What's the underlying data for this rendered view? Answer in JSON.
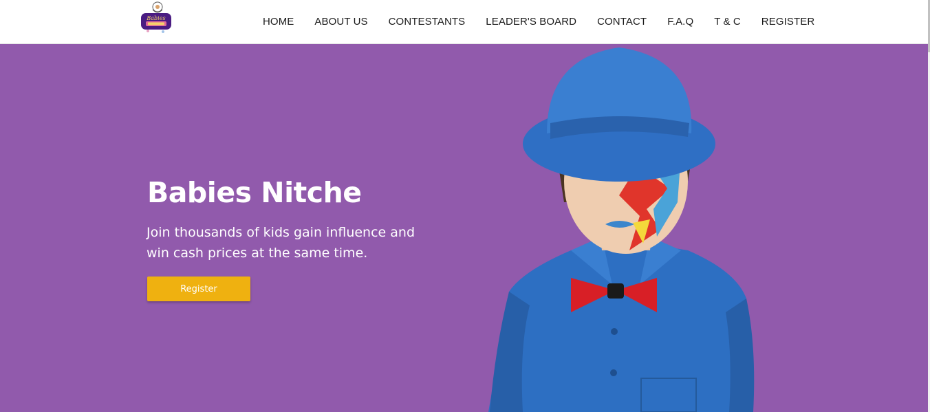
{
  "brand": {
    "logo_icon": "babies-nitche-logo-icon",
    "logo_text": "Babies Nitche"
  },
  "nav": {
    "items": [
      {
        "label": "HOME"
      },
      {
        "label": "ABOUT US"
      },
      {
        "label": "CONTESTANTS"
      },
      {
        "label": "LEADER'S BOARD"
      },
      {
        "label": "CONTACT"
      },
      {
        "label": "F.A.Q"
      },
      {
        "label": "T & C"
      },
      {
        "label": "REGISTER"
      }
    ]
  },
  "hero": {
    "title": "Babies Nitche",
    "subtitle": "Join thousands of kids gain influence and win cash prices at the same time.",
    "cta_label": "Register",
    "image_icon": "face-painted-child-image"
  },
  "colors": {
    "hero_background": "#915aac",
    "cta_background": "#efb110",
    "nav_text": "#1a1a1a"
  }
}
